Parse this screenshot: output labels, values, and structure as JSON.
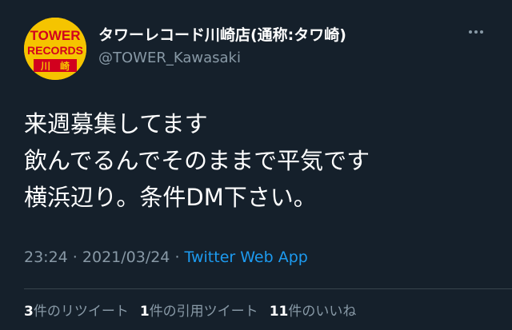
{
  "tweet": {
    "author": {
      "display_name": "タワーレコード川崎店(通称:タワ崎)",
      "handle": "@TOWER_Kawasaki",
      "avatar": {
        "line1": "TOWER",
        "line2": "RECORDS",
        "char1": "川",
        "char2": "崎",
        "bg_color": "#f5c400",
        "text_color": "#d2001e"
      }
    },
    "more_icon": "more-horizontal-icon",
    "text_lines": [
      "来週募集してます",
      "飲んでるんでそのままで平気です",
      "横浜辺り。条件DM下さい。"
    ],
    "time": "23:24",
    "separator": " · ",
    "date": "2021/03/24",
    "source_app": "Twitter Web App",
    "stats": {
      "retweets": {
        "count": "3",
        "label": "件のリツイート"
      },
      "quotes": {
        "count": "1",
        "label": "件の引用ツイート"
      },
      "likes": {
        "count": "11",
        "label": "件のいいね"
      }
    }
  },
  "colors": {
    "background": "#15202b",
    "primary_text": "#ffffff",
    "secondary_text": "#8899a6",
    "link": "#1d9bf0",
    "divider": "#38444d"
  }
}
